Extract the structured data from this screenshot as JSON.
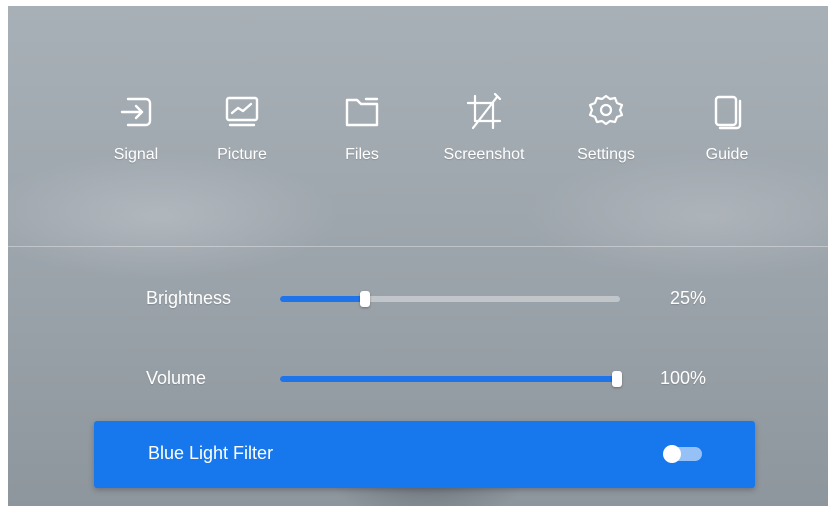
{
  "toolbar": {
    "items": [
      {
        "label": "Signal",
        "icon": "signal-input-icon"
      },
      {
        "label": "Picture",
        "icon": "picture-monitor-icon"
      },
      {
        "label": "Files",
        "icon": "folder-icon"
      },
      {
        "label": "Screenshot",
        "icon": "crop-icon"
      },
      {
        "label": "Settings",
        "icon": "gear-icon"
      },
      {
        "label": "Guide",
        "icon": "book-icon"
      }
    ]
  },
  "sliders": {
    "brightness": {
      "label": "Brightness",
      "value_text": "25%",
      "level": 0.25
    },
    "volume": {
      "label": "Volume",
      "value_text": "100%",
      "level": 1.0
    }
  },
  "blue_light_filter": {
    "label": "Blue Light Filter",
    "enabled": false
  },
  "colors": {
    "accent": "#1777ed",
    "slider_fill": "#1e74e8"
  }
}
